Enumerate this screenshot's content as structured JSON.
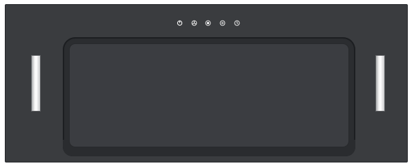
{
  "product": {
    "touch_controls": [
      {
        "icon": "power-icon"
      },
      {
        "icon": "fan-speed-icon"
      },
      {
        "icon": "boost-icon"
      },
      {
        "icon": "light-icon"
      },
      {
        "icon": "timer-icon"
      }
    ],
    "lights": [
      "left-led-strip",
      "right-led-strip"
    ]
  },
  "colors": {
    "body": "#3a3c3f",
    "frame": "#2b2d30",
    "icon": "#ffffff",
    "light": "#f4f4f4"
  }
}
